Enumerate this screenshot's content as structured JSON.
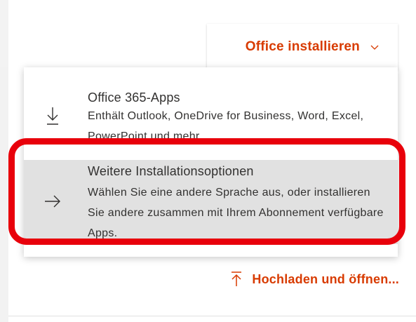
{
  "header": {
    "install_button_label": "Office installieren",
    "install_button_icon": "chevron-down-icon"
  },
  "menu": {
    "items": [
      {
        "title": "Office 365-Apps",
        "description": "Enthält Outlook, OneDrive for Business, Word, Excel, PowerPoint und mehr.",
        "icon": "download-arrow-icon"
      },
      {
        "title": "Weitere Installationsoptionen",
        "description": "Wählen Sie eine andere Sprache aus, oder installieren Sie andere zusammen mit Ihrem Abonnement verfügbare Apps.",
        "icon": "arrow-right-icon",
        "highlighted": true
      }
    ]
  },
  "upload": {
    "label": "Hochladen und öffnen...",
    "icon": "upload-arrow-icon"
  },
  "colors": {
    "accent": "#d83b01",
    "annotation_red": "#e8000b",
    "hover_background": "#e1e1e1",
    "text": "#323130"
  }
}
